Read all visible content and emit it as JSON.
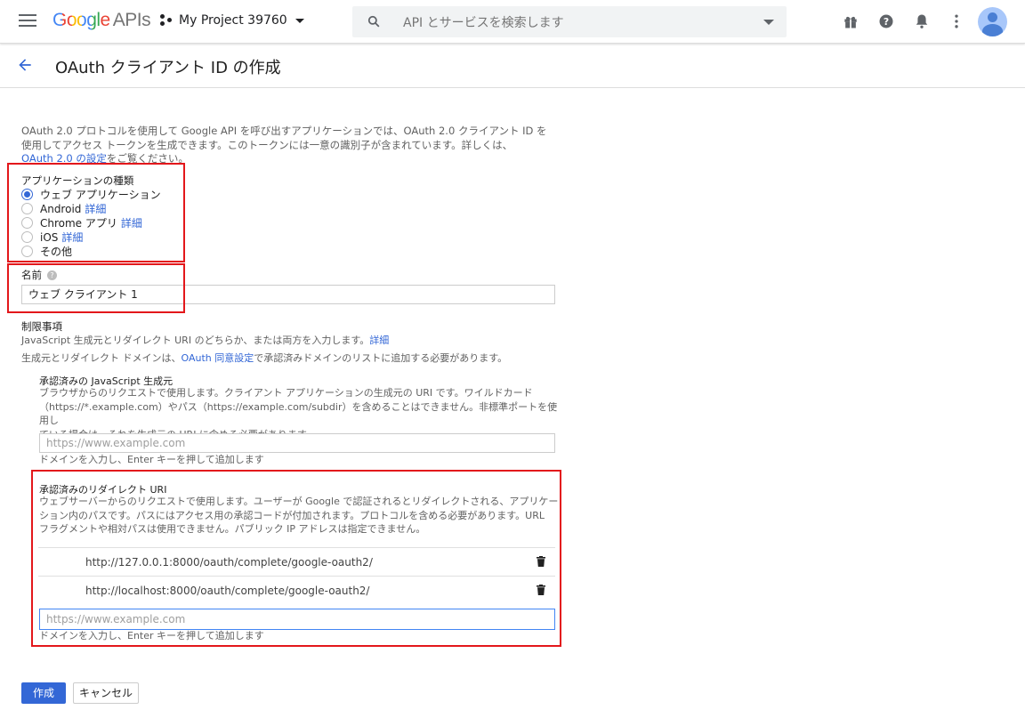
{
  "topbar": {
    "logo_google": "Google",
    "logo_apis": "APIs",
    "project_name": "My Project 39760",
    "search_placeholder": "API とサービスを検索します"
  },
  "page": {
    "title": "OAuth クライアント ID の作成"
  },
  "intro": {
    "line1": "OAuth 2.0 プロトコルを使用して Google API を呼び出すアプリケーションでは、OAuth 2.0 クライアント ID を",
    "line2": "使用してアクセス トークンを生成できます。このトークンには一意の識別子が含まれています。詳しくは、",
    "link": "OAuth 2.0 の設定",
    "line3_tail": "をご覧ください。"
  },
  "app_type": {
    "label": "アプリケーションの種類",
    "options": [
      {
        "label": "ウェブ アプリケーション",
        "detail": "",
        "selected": true
      },
      {
        "label": "Android",
        "detail": "詳細",
        "selected": false
      },
      {
        "label": "Chrome アプリ",
        "detail": "詳細",
        "selected": false
      },
      {
        "label": "iOS",
        "detail": "詳細",
        "selected": false
      },
      {
        "label": "その他",
        "detail": "",
        "selected": false
      }
    ]
  },
  "name": {
    "label": "名前",
    "help": "?",
    "value": "ウェブ クライアント 1"
  },
  "restrictions": {
    "title": "制限事項",
    "desc1": "JavaScript 生成元とリダイレクト URI のどちらか、または両方を入力します。",
    "desc1_link": "詳細",
    "desc2_a": "生成元とリダイレクト ドメインは、",
    "desc2_link": "OAuth 同意設定",
    "desc2_b": "で承認済みドメインのリストに追加する必要があります。"
  },
  "js_origins": {
    "title": "承認済みの JavaScript 生成元",
    "desc1": "ブラウザからのリクエストで使用します。クライアント アプリケーションの生成元の URI です。ワイルドカード",
    "desc2": "（https://*.example.com）やパス（https://example.com/subdir）を含めることはできません。非標準ポートを使用し",
    "desc3": "ている場合は、それを生成元の URI に含める必要があります。",
    "placeholder": "https://www.example.com",
    "hint": "ドメインを入力し、Enter キーを押して追加します"
  },
  "redirect_uris": {
    "title": "承認済みのリダイレクト URI",
    "desc1": "ウェブサーバーからのリクエストで使用します。ユーザーが Google で認証されるとリダイレクトされる、アプリケー",
    "desc2": "ション内のパスです。パスにはアクセス用の承認コードが付加されます。プロトコルを含める必要があります。URL",
    "desc3": "フラグメントや相対パスは使用できません。パブリック IP アドレスは指定できません。",
    "items": [
      "http://127.0.0.1:8000/oauth/complete/google-oauth2/",
      "http://localhost:8000/oauth/complete/google-oauth2/"
    ],
    "placeholder": "https://www.example.com",
    "hint": "ドメインを入力し、Enter キーを押して追加します"
  },
  "actions": {
    "create": "作成",
    "cancel": "キャンセル"
  },
  "colors": {
    "accent": "#3367d6",
    "highlight": "#e3171b"
  }
}
